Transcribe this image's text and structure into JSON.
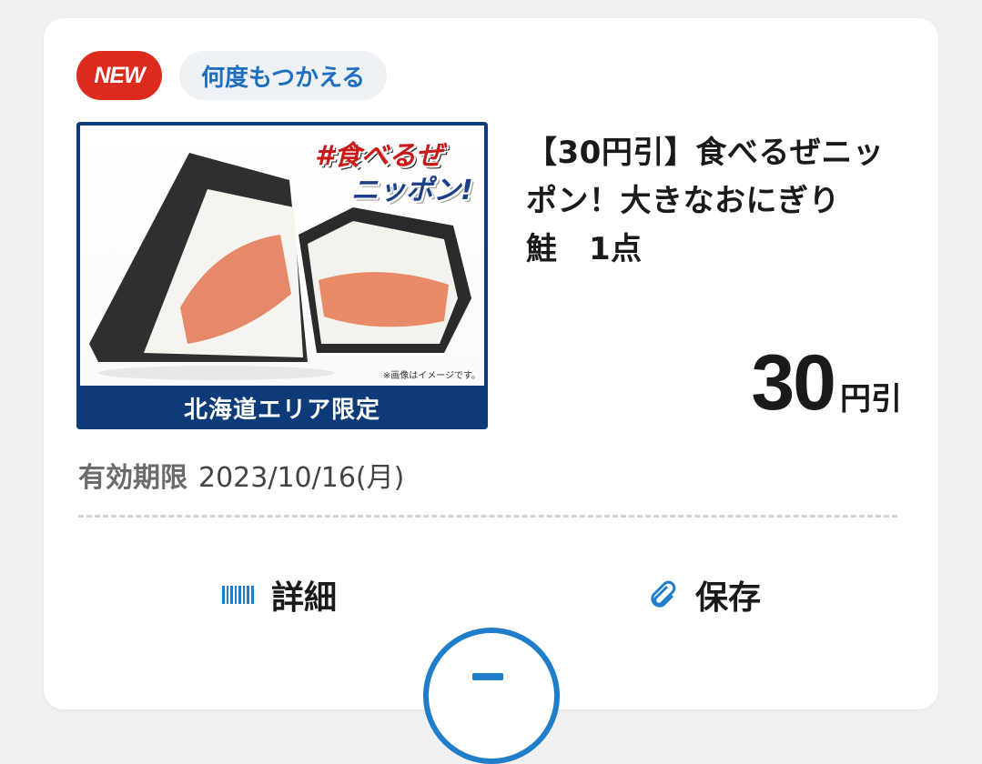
{
  "colors": {
    "new_badge_bg": "#dc2a1c",
    "reuse_badge_bg": "#eef1f5",
    "reuse_badge_text": "#1f6fbf",
    "accent_blue": "#1f7dc9",
    "caption_bar_bg": "#0d3a78"
  },
  "badges": {
    "new": "NEW",
    "reusable": "何度もつかえる"
  },
  "product": {
    "image_tag_line1": "#食べるぜ",
    "image_tag_line2": "ニッポン!",
    "image_note": "※画像はイメージです。",
    "image_caption": "北海道エリア限定",
    "title": "【30円引】食べるぜニッポン！大きなおにぎり　鮭　1点"
  },
  "price": {
    "amount": "30",
    "unit": "円引"
  },
  "expiry": {
    "label": "有効期限",
    "date": "2023/10/16(月)"
  },
  "actions": {
    "detail_label": "詳細",
    "detail_icon": "barcode-icon",
    "save_label": "保存",
    "save_icon": "paperclip-icon"
  }
}
